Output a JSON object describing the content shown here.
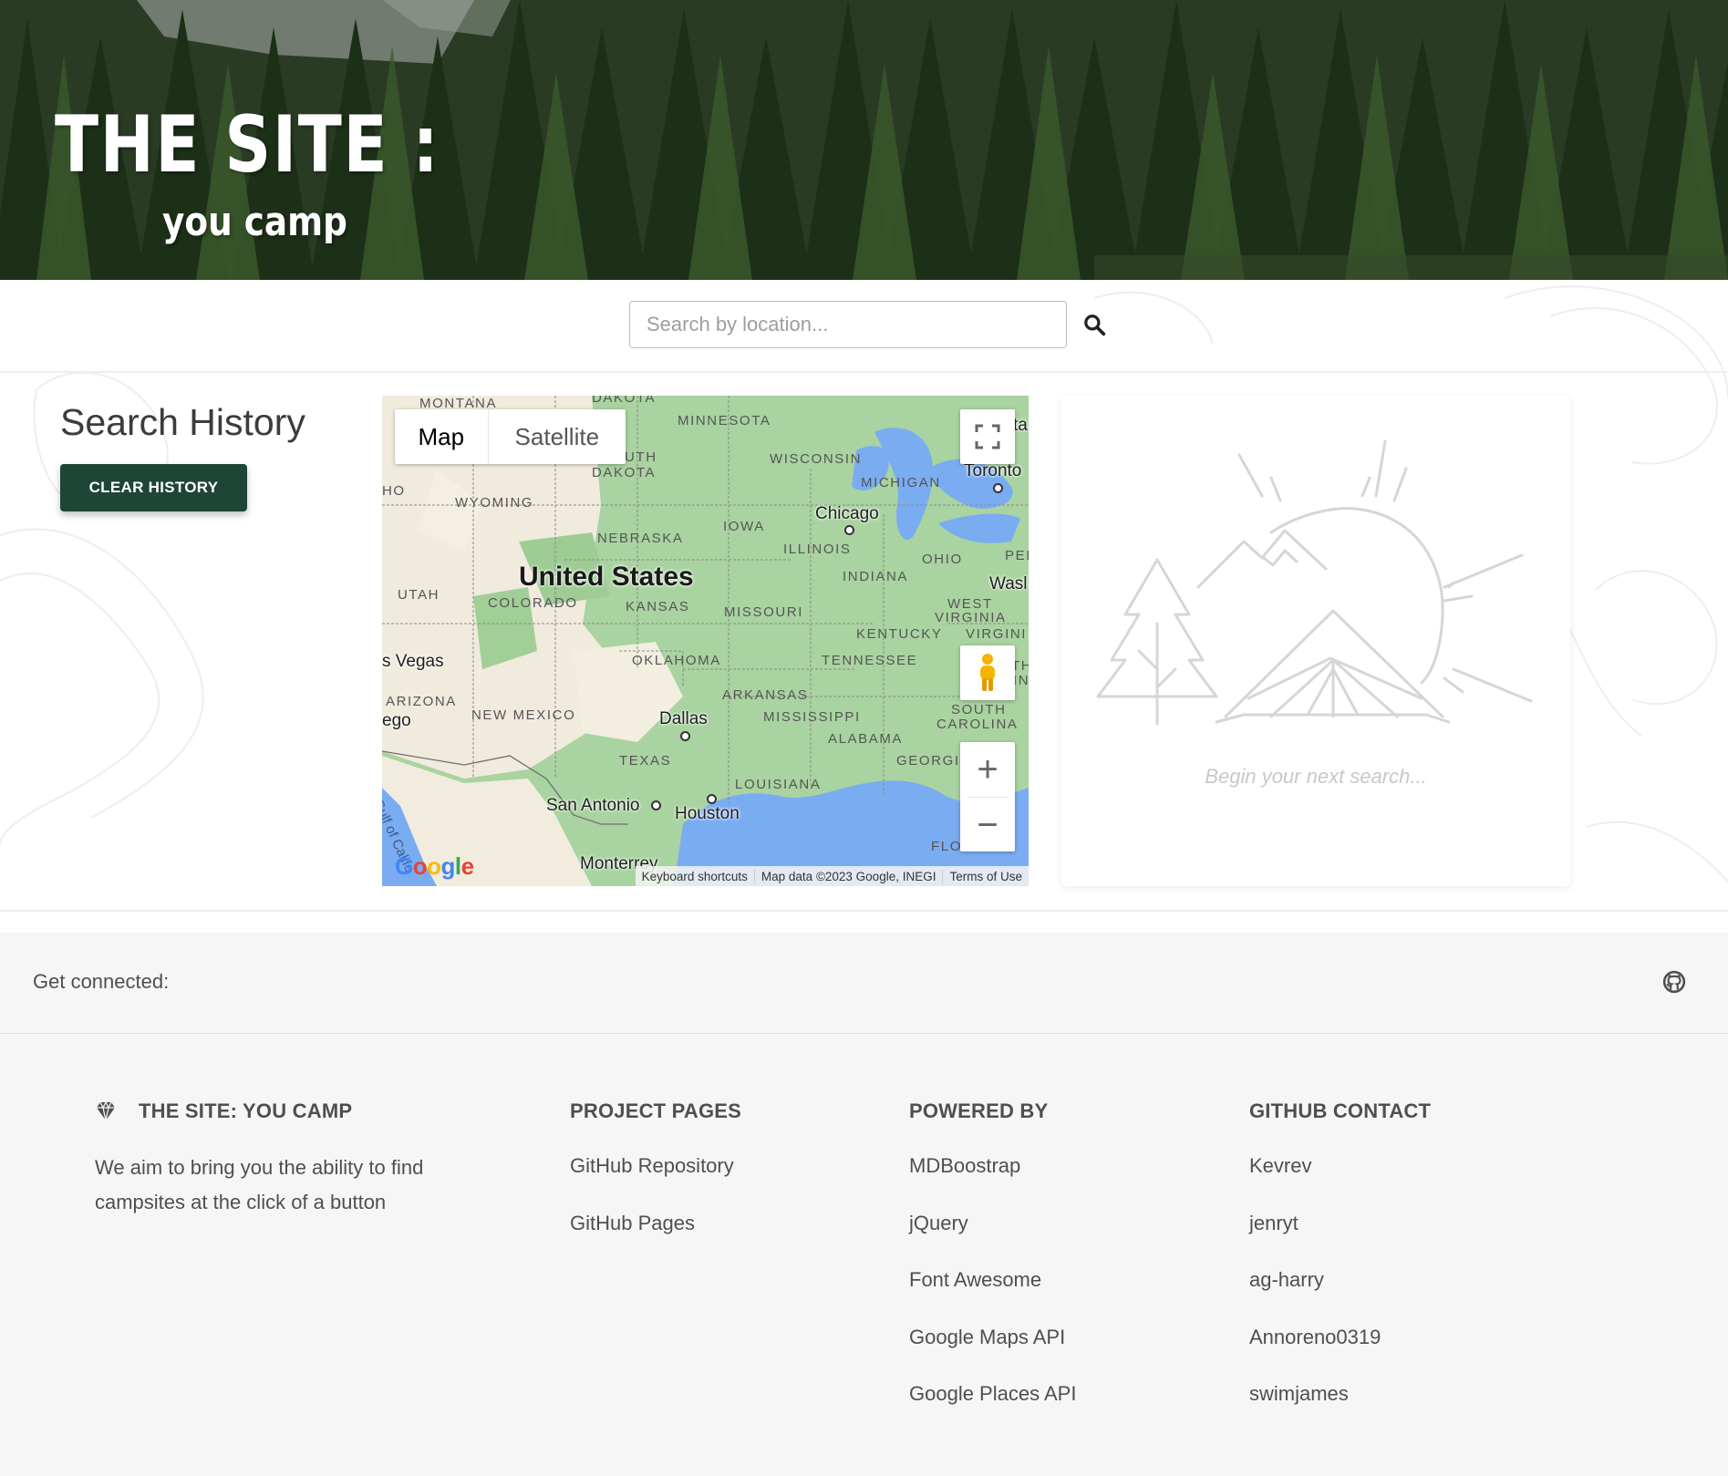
{
  "hero": {
    "title": "THE SITE :",
    "subtitle": "you camp"
  },
  "search": {
    "placeholder": "Search by location...",
    "button_icon": "search-icon"
  },
  "history": {
    "title": "Search History",
    "clear_label": "CLEAR HISTORY"
  },
  "map": {
    "type_map": "Map",
    "type_satellite": "Satellite",
    "country": "United States",
    "states": [
      "MONTANA",
      "DAKOTA",
      "MINNESOTA",
      "WISCONSIN",
      "MICHIGAN",
      "UTH",
      "DAKOTA",
      "WYOMING",
      "NEBRASKA",
      "IOWA",
      "ILLINOIS",
      "OHIO",
      "INDIANA",
      "UTAH",
      "COLORADO",
      "KANSAS",
      "MISSOURI",
      "WEST",
      "VIRGINIA",
      "KENTUCKY",
      "VIRGINI",
      "OKLAHOMA",
      "TENNESSEE",
      "ARKANSAS",
      "ARIZONA",
      "NEW MEXICO",
      "MISSISSIPPI",
      "ALABAMA",
      "SOUTH",
      "CAROLINA",
      "TEXAS",
      "GEORGI",
      "LOUISIANA",
      "FLO",
      "HO",
      "PEI",
      "TH",
      "IN"
    ],
    "cities": [
      "Chicago",
      "Toronto",
      "Wasl",
      "s Vegas",
      "Dallas",
      "ego",
      "San Antonio",
      "Houston",
      "Monterrey",
      "ta"
    ],
    "gulf_label": "Gulf of Califo",
    "google_logo": "Google",
    "footer_keyboard": "Keyboard shortcuts",
    "footer_data": "Map data ©2023 Google, INEGI",
    "footer_terms": "Terms of Use",
    "zoom_in": "+",
    "zoom_out": "−"
  },
  "results": {
    "empty_text": "Begin your next search..."
  },
  "social": {
    "label": "Get connected:",
    "icon": "github-icon"
  },
  "footer": {
    "brand_title": "THE SITE: YOU CAMP",
    "brand_icon": "gem-icon",
    "brand_desc": "We aim to bring you the ability to find campsites at the click of a button",
    "project_title": "PROJECT PAGES",
    "project_links": [
      "GitHub Repository",
      "GitHub Pages"
    ],
    "powered_title": "POWERED BY",
    "powered_links": [
      "MDBoostrap",
      "jQuery",
      "Font Awesome",
      "Google Maps API",
      "Google Places API"
    ],
    "contact_title": "GITHUB CONTACT",
    "contact_links": [
      "Kevrev",
      "jenryt",
      "ag-harry",
      "Annoreno0319",
      "swimjames"
    ]
  },
  "colors": {
    "primary_button": "#1e4536",
    "footer_bg": "#f6f6f6",
    "map_land": "#a9d3a0",
    "map_water": "#7aacf2"
  }
}
